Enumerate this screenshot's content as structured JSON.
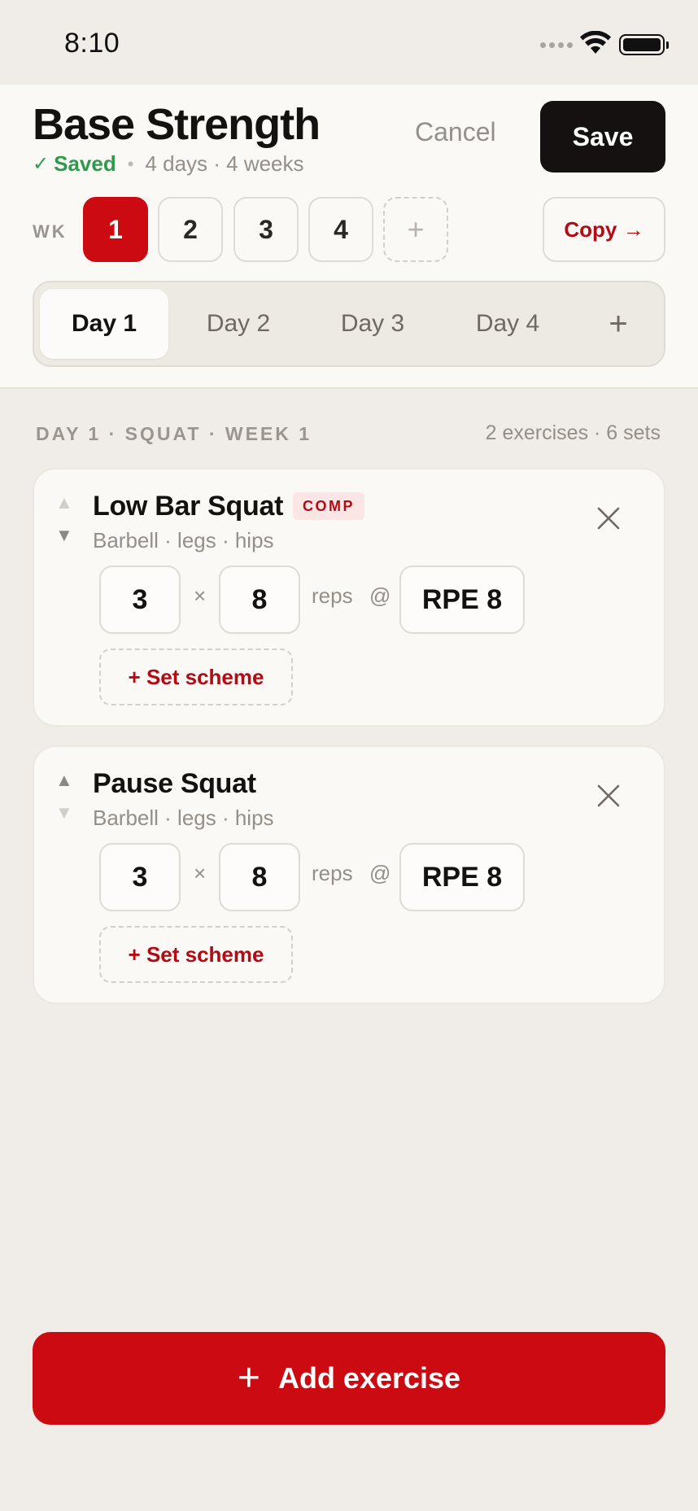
{
  "status_bar": {
    "time": "8:10"
  },
  "header": {
    "title": "Base Strength",
    "saved_label": "Saved",
    "meta_info": "4 days · 4 weeks",
    "cancel_label": "Cancel",
    "save_label": "Save"
  },
  "weeks": {
    "label": "WK",
    "items": [
      "1",
      "2",
      "3",
      "4"
    ],
    "active": "1",
    "add_label": "+",
    "copy_label": "Copy →"
  },
  "days": {
    "tabs": [
      "Day 1",
      "Day 2",
      "Day 3",
      "Day 4"
    ],
    "active": "Day 1",
    "add_label": "+"
  },
  "section": {
    "title": "DAY 1 · SQUAT · WEEK 1",
    "count": "2 exercises · 6 sets"
  },
  "exercises": [
    {
      "name": "Low Bar Squat",
      "badge": "COMP",
      "sub": "Barbell · legs · hips",
      "sets": "3",
      "times": "×",
      "reps": "8",
      "reps_label": "reps",
      "at": "@",
      "intensity": "RPE 8",
      "scheme_label": "+ Set scheme"
    },
    {
      "name": "Pause Squat",
      "sub": "Barbell · legs · hips",
      "sets": "3",
      "times": "×",
      "reps": "8",
      "reps_label": "reps",
      "at": "@",
      "intensity": "RPE 8",
      "scheme_label": "+ Set scheme"
    }
  ],
  "footer": {
    "add_exercise_label": "Add exercise",
    "add_icon": "+"
  },
  "colors": {
    "accent": "#cc0a12",
    "saved_green": "#2f9a4c",
    "background": "#f0ece7"
  }
}
